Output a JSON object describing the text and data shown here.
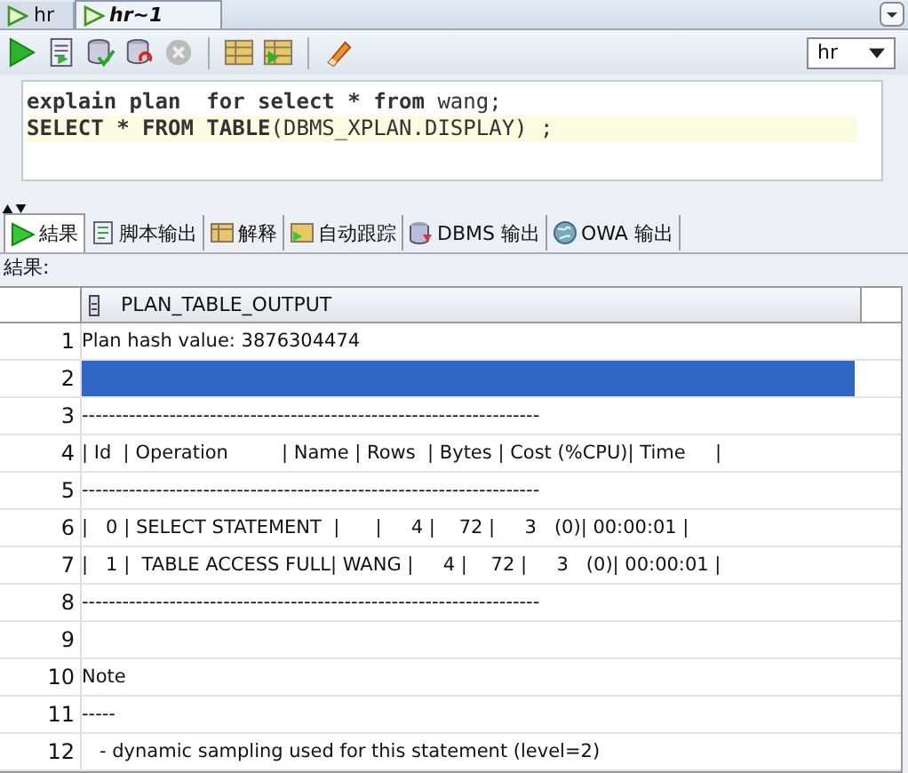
{
  "tabs": [
    {
      "label": "hr",
      "selected": false
    },
    {
      "label": "hr~1",
      "selected": true
    }
  ],
  "connection": {
    "value": "hr"
  },
  "editor": {
    "lines": [
      {
        "text": "**explain plan  for select * from** wang;",
        "current": false
      },
      {
        "text": "**SELECT * FROM TABLE**(DBMS_XPLAN.DISPLAY) ;",
        "current": true
      }
    ]
  },
  "result_tabs": [
    {
      "label": "結果",
      "selected": true
    },
    {
      "label": "脚本输出",
      "selected": false
    },
    {
      "label": "解释",
      "selected": false
    },
    {
      "label": "自动跟踪",
      "selected": false
    },
    {
      "label": "DBMS 输出",
      "selected": false
    },
    {
      "label": "OWA 输出",
      "selected": false
    }
  ],
  "result_label": "結果:",
  "table": {
    "columns": [
      "PLAN_TABLE_OUTPUT"
    ],
    "rows": [
      {
        "number": "1",
        "text": "Plan hash value: 3876304474",
        "selected": false
      },
      {
        "number": "2",
        "selected": true
      },
      {
        "number": "3",
        "text": "--------------------------------------------------------------------",
        "selected": false
      },
      {
        "number": "4",
        "text": "| Id  | Operation         | Name | Rows  | Bytes | Cost (%CPU)| Time     |",
        "selected": false
      },
      {
        "number": "5",
        "text": "--------------------------------------------------------------------",
        "selected": false
      },
      {
        "number": "6",
        "text": "|   0 | SELECT STATEMENT  |      |     4 |    72 |     3   (0)| 00:00:01 |",
        "selected": false
      },
      {
        "number": "7",
        "text": "|   1 |  TABLE ACCESS FULL| WANG |     4 |    72 |     3   (0)| 00:00:01 |",
        "selected": false
      },
      {
        "number": "8",
        "text": "--------------------------------------------------------------------",
        "selected": false
      },
      {
        "number": "9",
        "selected": false
      },
      {
        "number": "10",
        "text": "Note",
        "selected": false
      },
      {
        "number": "11",
        "text": "-----",
        "selected": false
      },
      {
        "number": "12",
        "text": "   - dynamic sampling used for this statement (level=2)",
        "selected": false
      }
    ]
  }
}
